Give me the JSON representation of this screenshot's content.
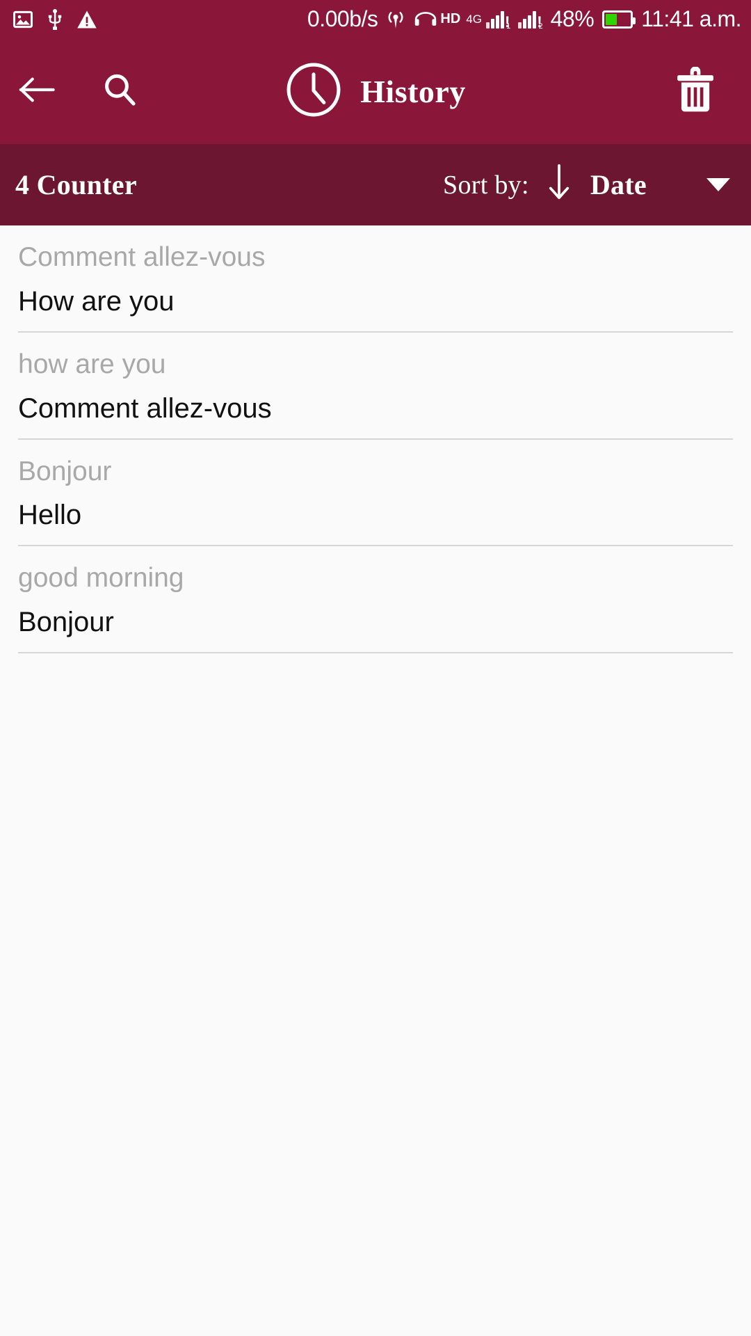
{
  "status_bar": {
    "icons": [
      "image-icon",
      "usb-icon",
      "warning-icon"
    ],
    "network_speed": "0.00b/s",
    "hotspot": "hotspot-icon",
    "hd_label": "HD",
    "network_type": "4G",
    "sim1_label": "1",
    "sim2_label": "2",
    "battery_percent": "48%",
    "battery_level": 48,
    "battery_color": "#2ED500",
    "time": "11:41 a.m."
  },
  "app_bar": {
    "back_icon": "back-arrow-icon",
    "search_icon": "search-icon",
    "clock_icon": "clock-icon",
    "title": "History",
    "delete_icon": "trash-icon",
    "background": "#8A1739"
  },
  "sort_bar": {
    "counter": "4 Counter",
    "sort_label": "Sort by:",
    "sort_direction_icon": "arrow-down-icon",
    "sort_value": "Date",
    "dropdown_icon": "caret-down-icon",
    "background": "#6D1631"
  },
  "history": {
    "items": [
      {
        "source": "Comment allez-vous",
        "target": "How are you"
      },
      {
        "source": "how are you",
        "target": "Comment allez-vous"
      },
      {
        "source": "Bonjour",
        "target": "Hello"
      },
      {
        "source": "good morning",
        "target": "Bonjour"
      }
    ]
  },
  "colors": {
    "primary": "#8A1739",
    "primary_dark": "#6D1631",
    "content_bg": "#FAFAFA",
    "source_text": "#A8A8A8",
    "target_text": "#111111",
    "divider": "#D6D6D6"
  }
}
